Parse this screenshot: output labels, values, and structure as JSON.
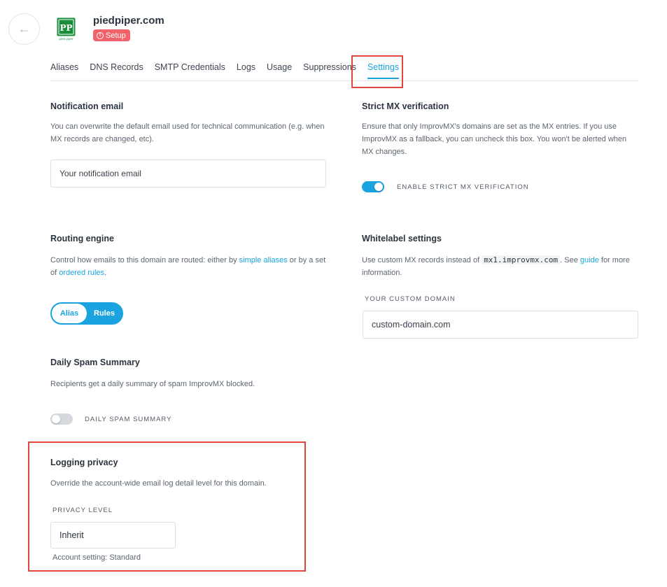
{
  "header": {
    "back_icon": "←",
    "domain": "piedpiper.com",
    "badge_icon": "!",
    "badge": "Setup",
    "logo_text": "PP",
    "logo_caption": "pied piper",
    "logo_color": "#1a8d3a"
  },
  "tabs": [
    "Aliases",
    "DNS Records",
    "SMTP Credentials",
    "Logs",
    "Usage",
    "Suppressions",
    "Settings"
  ],
  "active_tab": "Settings",
  "notification": {
    "title": "Notification email",
    "desc": "You can overwrite the default email used for technical communication (e.g. when MX records are changed, etc).",
    "placeholder": "Your notification email"
  },
  "strict_mx": {
    "title": "Strict MX verification",
    "desc": "Ensure that only ImprovMX's domains are set as the MX entries. If you use ImprovMX as a fallback, you can uncheck this box. You won't be alerted when MX changes.",
    "toggle_label": "ENABLE STRICT MX VERIFICATION",
    "enabled": true
  },
  "routing": {
    "title": "Routing engine",
    "desc_1": "Control how emails to this domain are routed: either by ",
    "link_1": "simple aliases",
    "desc_2": " or by a set of ",
    "link_2": "ordered rules",
    "desc_3": ".",
    "option_alias": "Alias",
    "option_rules": "Rules"
  },
  "whitelabel": {
    "title": "Whitelabel settings",
    "desc_1": "Use custom MX records instead of ",
    "code": "mx1.improvmx.com",
    "desc_2": ". See ",
    "link": "guide",
    "desc_3": " for more information.",
    "field_label": "YOUR CUSTOM DOMAIN",
    "placeholder": "custom-domain.com"
  },
  "spam": {
    "title": "Daily Spam Summary",
    "desc": "Recipients get a daily summary of spam ImprovMX blocked.",
    "toggle_label": "DAILY SPAM SUMMARY",
    "enabled": false
  },
  "logging": {
    "title": "Logging privacy",
    "desc": "Override the account-wide email log detail level for this domain.",
    "field_label": "PRIVACY LEVEL",
    "value": "Inherit",
    "note": "Account setting: Standard"
  },
  "colors": {
    "accent": "#1aa3df",
    "badge": "#f2626a",
    "highlight": "#e0483e"
  }
}
